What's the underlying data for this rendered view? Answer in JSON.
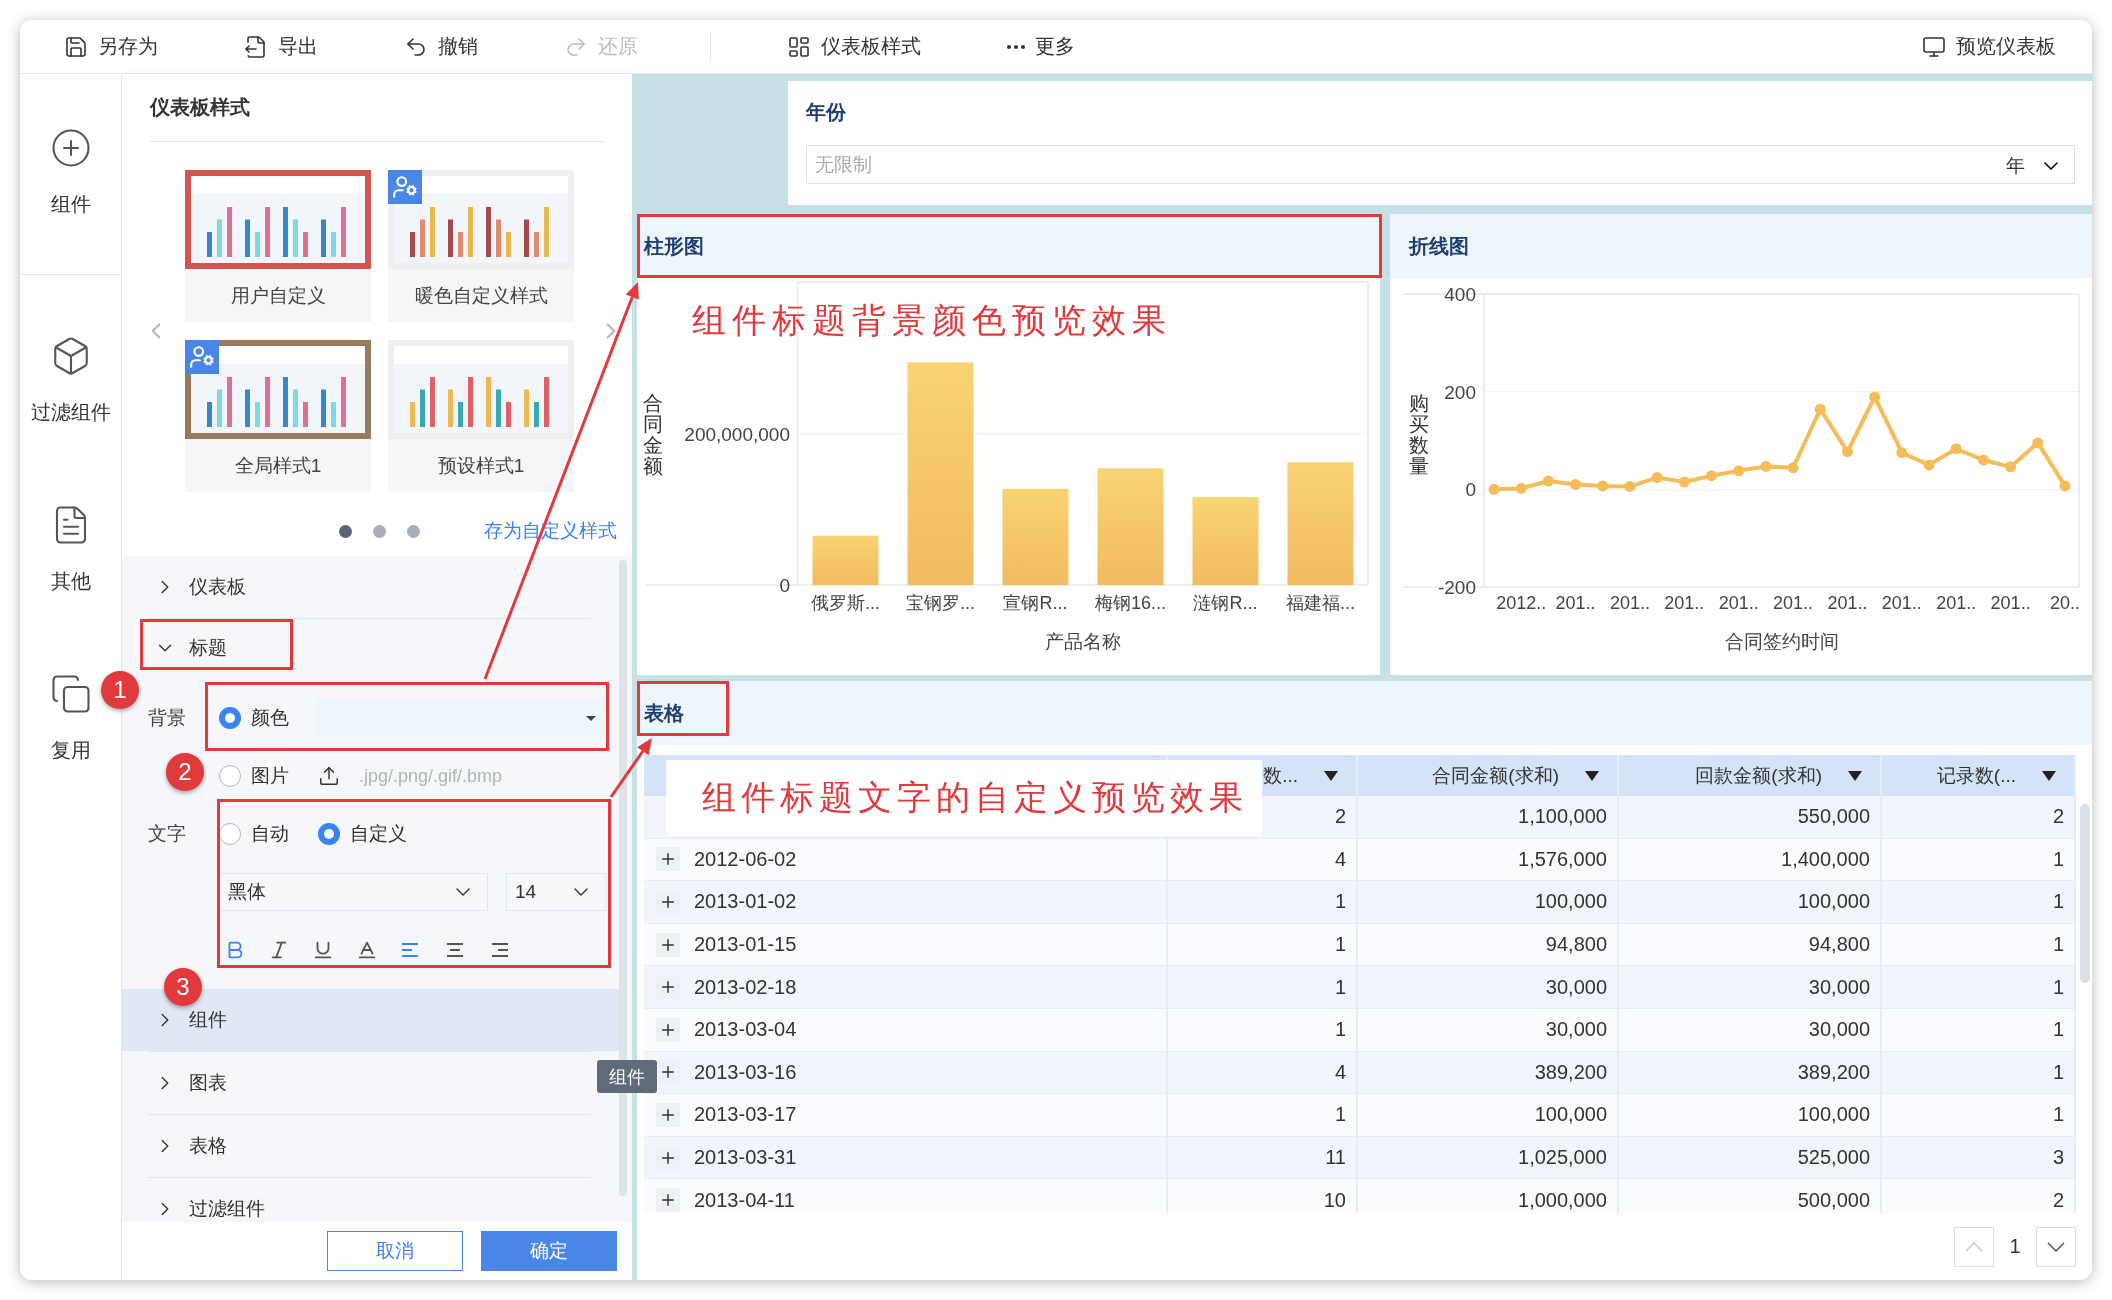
{
  "toolbar": {
    "items": [
      {
        "label": "另存为",
        "kind": "save",
        "disabled": false
      },
      {
        "label": "导出",
        "kind": "export",
        "disabled": false
      },
      {
        "label": "撤销",
        "kind": "undo",
        "disabled": false
      },
      {
        "label": "还原",
        "kind": "redo",
        "disabled": true
      },
      {
        "label": "仪表板样式",
        "kind": "style",
        "disabled": false
      },
      {
        "label": "更多",
        "kind": "more",
        "disabled": false
      }
    ],
    "preview": "预览仪表板"
  },
  "rail": [
    {
      "label": "组件",
      "kind": "add"
    },
    {
      "label": "过滤组件",
      "kind": "cube"
    },
    {
      "label": "其他",
      "kind": "doc"
    },
    {
      "label": "复用",
      "kind": "copy"
    }
  ],
  "style_panel": {
    "title": "仪表板样式",
    "themes": [
      {
        "name": "用户自定义",
        "kind": "cool",
        "selected": true,
        "applied": false,
        "badge": false
      },
      {
        "name": "暖色自定义样式",
        "kind": "warm",
        "selected": false,
        "applied": false,
        "badge": true
      },
      {
        "name": "全局样式1",
        "kind": "cool",
        "selected": false,
        "applied": true,
        "badge": true
      },
      {
        "name": "预设样式1",
        "kind": "bright",
        "selected": false,
        "applied": false,
        "badge": false
      }
    ],
    "pages": [
      {
        "selected": true
      },
      {
        "selected": false
      },
      {
        "selected": false
      }
    ],
    "save_link": "存为自定义样式",
    "sections": [
      {
        "label": "仪表板",
        "expanded": false,
        "highlighted": false
      },
      {
        "label": "标题",
        "expanded": true,
        "highlighted": false,
        "settings": {
          "background_label": "背景",
          "background_options": [
            {
              "label": "颜色",
              "selected": true
            },
            {
              "label": "图片",
              "selected": false
            }
          ],
          "upload_hint": ".jpg/.png/.gif/.bmp",
          "text_label": "文字",
          "text_options": [
            {
              "label": "自动",
              "selected": false
            },
            {
              "label": "自定义",
              "selected": true
            }
          ],
          "font": "黑体",
          "size": "14",
          "format": [
            {
              "kind": "bold",
              "on": true
            },
            {
              "kind": "italic",
              "on": false
            },
            {
              "kind": "underline",
              "on": false
            },
            {
              "kind": "color",
              "on": false
            },
            {
              "kind": "align-left",
              "on": true
            },
            {
              "kind": "align-center",
              "on": false
            },
            {
              "kind": "align-right",
              "on": false
            }
          ]
        }
      },
      {
        "label": "组件",
        "expanded": false,
        "highlighted": true
      },
      {
        "label": "图表",
        "expanded": false,
        "highlighted": false
      },
      {
        "label": "表格",
        "expanded": false,
        "highlighted": false
      },
      {
        "label": "过滤组件",
        "expanded": false,
        "highlighted": false
      }
    ],
    "buttons": {
      "cancel": "取消",
      "ok": "确定"
    },
    "tooltip": "组件"
  },
  "dashboard": {
    "filter": {
      "title": "年份",
      "placeholder": "无限制",
      "unit": "年"
    },
    "bar_chart": {
      "title": "柱形图",
      "chart_data": {
        "type": "bar",
        "xlabel": "产品名称",
        "ylabel": "合同金额",
        "categories": [
          "俄罗斯...",
          "宝钢罗...",
          "宣钢R...",
          "梅钢16...",
          "涟钢R...",
          "福建福..."
        ],
        "values": [
          65000000,
          294000000,
          127000000,
          154000000,
          116000000,
          162000000
        ],
        "ylim": [
          0,
          400000000
        ],
        "grid": true,
        "yticks": [
          {
            "value": 0,
            "label": "0"
          },
          {
            "value": 200000000,
            "label": "200,000,000"
          }
        ]
      }
    },
    "line_chart": {
      "title": "折线图",
      "chart_data": {
        "type": "line",
        "xlabel": "合同签约时间",
        "ylabel": "购买数量",
        "ylim": [
          -200,
          400
        ],
        "yticks": [
          -200,
          0,
          200,
          400
        ],
        "grid": true,
        "marker": "circle",
        "categories": [
          null,
          "2012..",
          null,
          "201..",
          null,
          "201..",
          null,
          "201..",
          null,
          "201..",
          null,
          "201..",
          null,
          "201..",
          null,
          "201..",
          null,
          "201..",
          null,
          "201..",
          null,
          "20.."
        ],
        "values": [
          0,
          2,
          17,
          10,
          7,
          6,
          24,
          15,
          28,
          38,
          47,
          44,
          164,
          77,
          189,
          75,
          50,
          83,
          60,
          46,
          95,
          7
        ]
      }
    },
    "table": {
      "title": "表格",
      "columns": [
        {
          "label": "数..."
        },
        {
          "label": "合同金额(求和)"
        },
        {
          "label": "回款金额(求和)"
        },
        {
          "label": "记录数(..."
        }
      ],
      "rows": [
        {
          "cells": [
            "2",
            "1,100,000",
            "550,000",
            "2"
          ]
        },
        {
          "date": "2012-06-02",
          "cells": [
            "4",
            "1,576,000",
            "1,400,000",
            "1"
          ]
        },
        {
          "date": "2013-01-02",
          "cells": [
            "1",
            "100,000",
            "100,000",
            "1"
          ]
        },
        {
          "date": "2013-01-15",
          "cells": [
            "1",
            "94,800",
            "94,800",
            "1"
          ]
        },
        {
          "date": "2013-02-18",
          "cells": [
            "1",
            "30,000",
            "30,000",
            "1"
          ]
        },
        {
          "date": "2013-03-04",
          "cells": [
            "1",
            "30,000",
            "30,000",
            "1"
          ]
        },
        {
          "date": "2013-03-16",
          "cells": [
            "4",
            "389,200",
            "389,200",
            "1"
          ]
        },
        {
          "date": "2013-03-17",
          "cells": [
            "1",
            "100,000",
            "100,000",
            "1"
          ]
        },
        {
          "date": "2013-03-31",
          "cells": [
            "11",
            "1,025,000",
            "525,000",
            "3"
          ]
        },
        {
          "date": "2013-04-11",
          "cells": [
            "10",
            "1,000,000",
            "500,000",
            "2"
          ]
        }
      ],
      "page": "1"
    }
  },
  "annotations": {
    "markers": [
      "1",
      "2",
      "3"
    ],
    "notes": [
      "组件标题背景颜色预览效果",
      "组件标题文字的自定义预览效果"
    ]
  }
}
